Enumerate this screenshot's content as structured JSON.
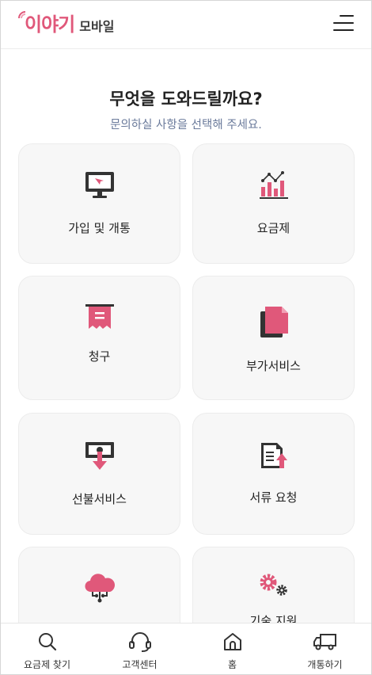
{
  "header": {
    "logo_main": "이야기",
    "logo_sub": "모바일"
  },
  "main": {
    "title": "무엇을 도와드릴까요?",
    "subtitle": "문의하실 사항을 선택해 주세요.",
    "cards": [
      {
        "label": "가입 및 개통",
        "icon": "monitor-icon"
      },
      {
        "label": "요금제",
        "icon": "chart-icon"
      },
      {
        "label": "청구",
        "icon": "receipt-icon"
      },
      {
        "label": "부가서비스",
        "icon": "documents-icon"
      },
      {
        "label": "선불서비스",
        "icon": "money-download-icon"
      },
      {
        "label": "서류 요청",
        "icon": "document-upload-icon"
      },
      {
        "label": "",
        "icon": "cloud-icon"
      },
      {
        "label": "기술 지원",
        "icon": "gears-icon"
      }
    ]
  },
  "tabbar": {
    "items": [
      {
        "label": "요금제 찾기",
        "icon": "search-icon"
      },
      {
        "label": "고객센터",
        "icon": "headset-icon"
      },
      {
        "label": "홈",
        "icon": "home-icon"
      },
      {
        "label": "개통하기",
        "icon": "truck-icon"
      }
    ]
  },
  "colors": {
    "accent": "#e0587a",
    "icon_dark": "#333333",
    "card_bg": "#f7f7f7"
  }
}
